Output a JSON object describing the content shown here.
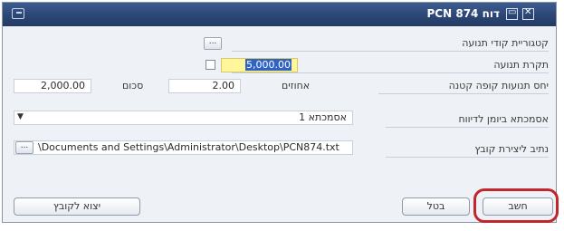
{
  "window": {
    "title": "דוח PCN 874",
    "controls": {
      "restore": "▭",
      "close": "✕"
    }
  },
  "rows": {
    "categories": {
      "label": "קטגוריית קודי תנועה",
      "button_label": "..."
    },
    "period": {
      "label": "תקרת תנועה",
      "value": "5,000.00"
    },
    "ratio": {
      "label": "יחס תנועות קופה קטנה",
      "percent_label": "אחוזים",
      "percent_value": "2.00",
      "sum_label": "סכום",
      "sum_value": "2,000.00"
    },
    "journal": {
      "label": "אסמכתא ביומן לדיווח",
      "value": "אסמכתא 1"
    },
    "file_path": {
      "label": "נתיב ליצירת קובץ",
      "value": "\\Documents and Settings\\Administrator\\Desktop\\PCN874.txt",
      "browse_label": "..."
    }
  },
  "buttons": {
    "calculate": "חשב",
    "cancel": "בטל",
    "export": "יצוא לקובץ"
  },
  "colors": {
    "highlight_circle": "#c0262c",
    "titlebar": "#2b4675"
  },
  "icons": [
    "window-menu-icon",
    "restore-icon",
    "close-icon",
    "dropdown-arrow-icon"
  ]
}
